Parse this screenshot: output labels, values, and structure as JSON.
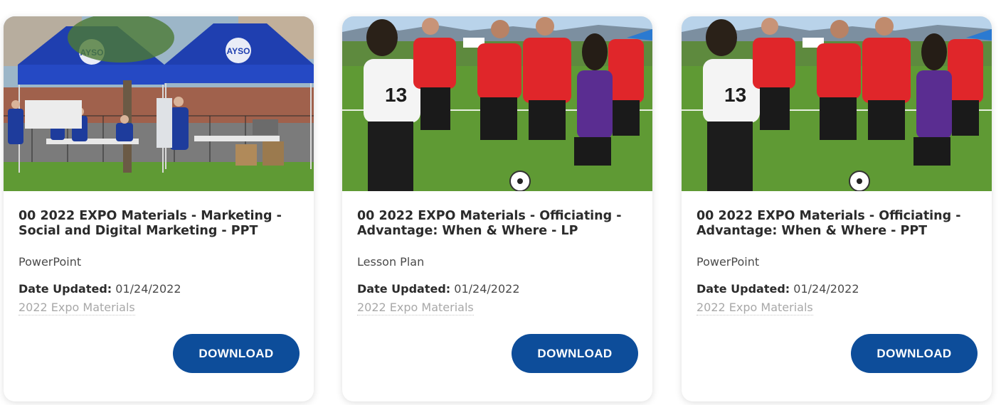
{
  "cards": [
    {
      "title_line1": "00 2022 EXPO Materials - Marketing -",
      "title_line2": "Social and Digital Marketing - PPT",
      "type": "PowerPoint",
      "date_label": "Date Updated:",
      "date_value": "01/24/2022",
      "category": "2022 Expo Materials",
      "button": "DOWNLOAD",
      "photo_text": "AYSO"
    },
    {
      "title_line1": "00 2022 EXPO Materials - Officiating -",
      "title_line2": "Advantage: When & Where - LP",
      "type": "Lesson Plan",
      "date_label": "Date Updated:",
      "date_value": "01/24/2022",
      "category": "2022 Expo Materials",
      "button": "DOWNLOAD",
      "photo_text": "13"
    },
    {
      "title_line1": "00 2022 EXPO Materials - Officiating -",
      "title_line2": "Advantage: When & Where - PPT",
      "type": "PowerPoint",
      "date_label": "Date Updated:",
      "date_value": "01/24/2022",
      "category": "2022 Expo Materials",
      "button": "DOWNLOAD",
      "photo_text": "13"
    }
  ],
  "colors": {
    "button": "#0d4d9a",
    "tent": "#1f3fb0",
    "referee_shirt": "#e0262a",
    "purple_jersey": "#5a2d91",
    "grass": "#5f9a34"
  }
}
